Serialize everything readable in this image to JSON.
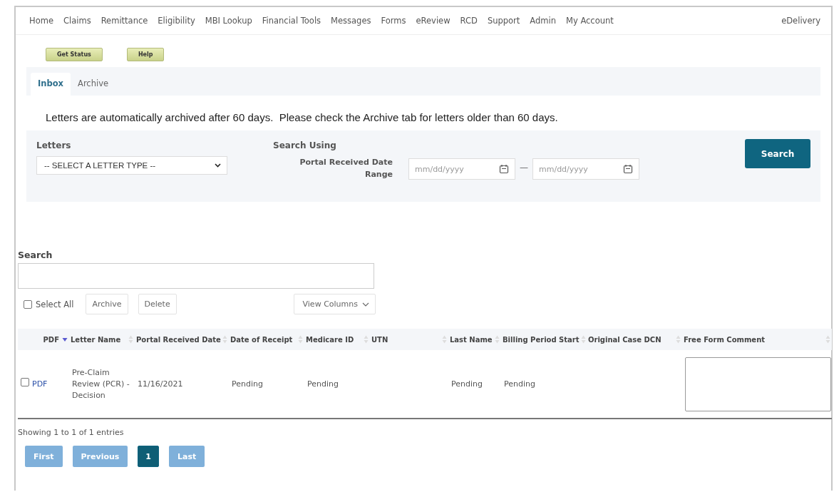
{
  "nav": {
    "items": [
      {
        "label": "Home"
      },
      {
        "label": "Claims"
      },
      {
        "label": "Remittance"
      },
      {
        "label": "Eligibility"
      },
      {
        "label": "MBI Lookup"
      },
      {
        "label": "Financial Tools"
      },
      {
        "label": "Messages"
      },
      {
        "label": "Forms"
      },
      {
        "label": "eReview"
      },
      {
        "label": "RCD"
      },
      {
        "label": "Support"
      },
      {
        "label": "Admin"
      },
      {
        "label": "My Account"
      }
    ],
    "right": "eDelivery"
  },
  "toolbar": [
    "Get Status",
    "Help"
  ],
  "tabs": [
    {
      "label": "Inbox",
      "selected": true
    },
    {
      "label": "Archive",
      "selected": false
    }
  ],
  "notice": "Letters are automatically archived after 60 days.  Please check the Archive tab for letters older than 60 days.",
  "filter": {
    "letters_label": "Letters",
    "letter_select": "-- SELECT A LETTER TYPE --",
    "search_using": "Search Using",
    "range_label": "Portal Received Date Range",
    "from_placeholder": "mm/dd/yyyy",
    "separator": "—",
    "to_placeholder": "mm/dd/yyyy",
    "search_button": "Search"
  },
  "search": {
    "label": "Search",
    "select_all": {
      "label": "Select All",
      "checked": false
    },
    "actions": [
      "Archive",
      "Delete"
    ],
    "view_columns": "View Columns"
  },
  "table": {
    "columns": [
      {
        "label": "PDF",
        "sorted": true
      },
      {
        "label": "Letter Name",
        "sorted": false
      },
      {
        "label": "Portal Received Date",
        "sorted": false
      },
      {
        "label": "Date of Receipt",
        "sorted": false
      },
      {
        "label": "Medicare ID",
        "sorted": false
      },
      {
        "label": "UTN",
        "sorted": false
      },
      {
        "label": "Last Name",
        "sorted": false
      },
      {
        "label": "Billing Period Start",
        "sorted": false
      },
      {
        "label": "Original Case DCN",
        "sorted": false
      },
      {
        "label": "Free Form Comment",
        "sorted": false
      }
    ],
    "rows": [
      {
        "checked": false,
        "cells": [
          {
            "kind": "link",
            "text": "PDF"
          },
          {
            "kind": "text",
            "text": "Pre-Claim Review (PCR) - Decision"
          },
          {
            "kind": "text",
            "text": "11/16/2021"
          },
          {
            "kind": "text",
            "text": "Pending"
          },
          {
            "kind": "text",
            "text": "Pending"
          },
          {
            "kind": "blank"
          },
          {
            "kind": "text",
            "text": "Pending"
          },
          {
            "kind": "text",
            "text": "Pending"
          },
          {
            "kind": "blank"
          },
          {
            "kind": "textarea"
          }
        ]
      }
    ]
  },
  "info": "Showing 1 to 1 of 1 entries",
  "pager": [
    {
      "label": "First",
      "kind": "nav",
      "disabled": true
    },
    {
      "label": "Previous",
      "kind": "nav",
      "disabled": true
    },
    {
      "label": "1",
      "kind": "page",
      "selected": true
    },
    {
      "label": "Last",
      "kind": "nav",
      "disabled": true
    }
  ]
}
